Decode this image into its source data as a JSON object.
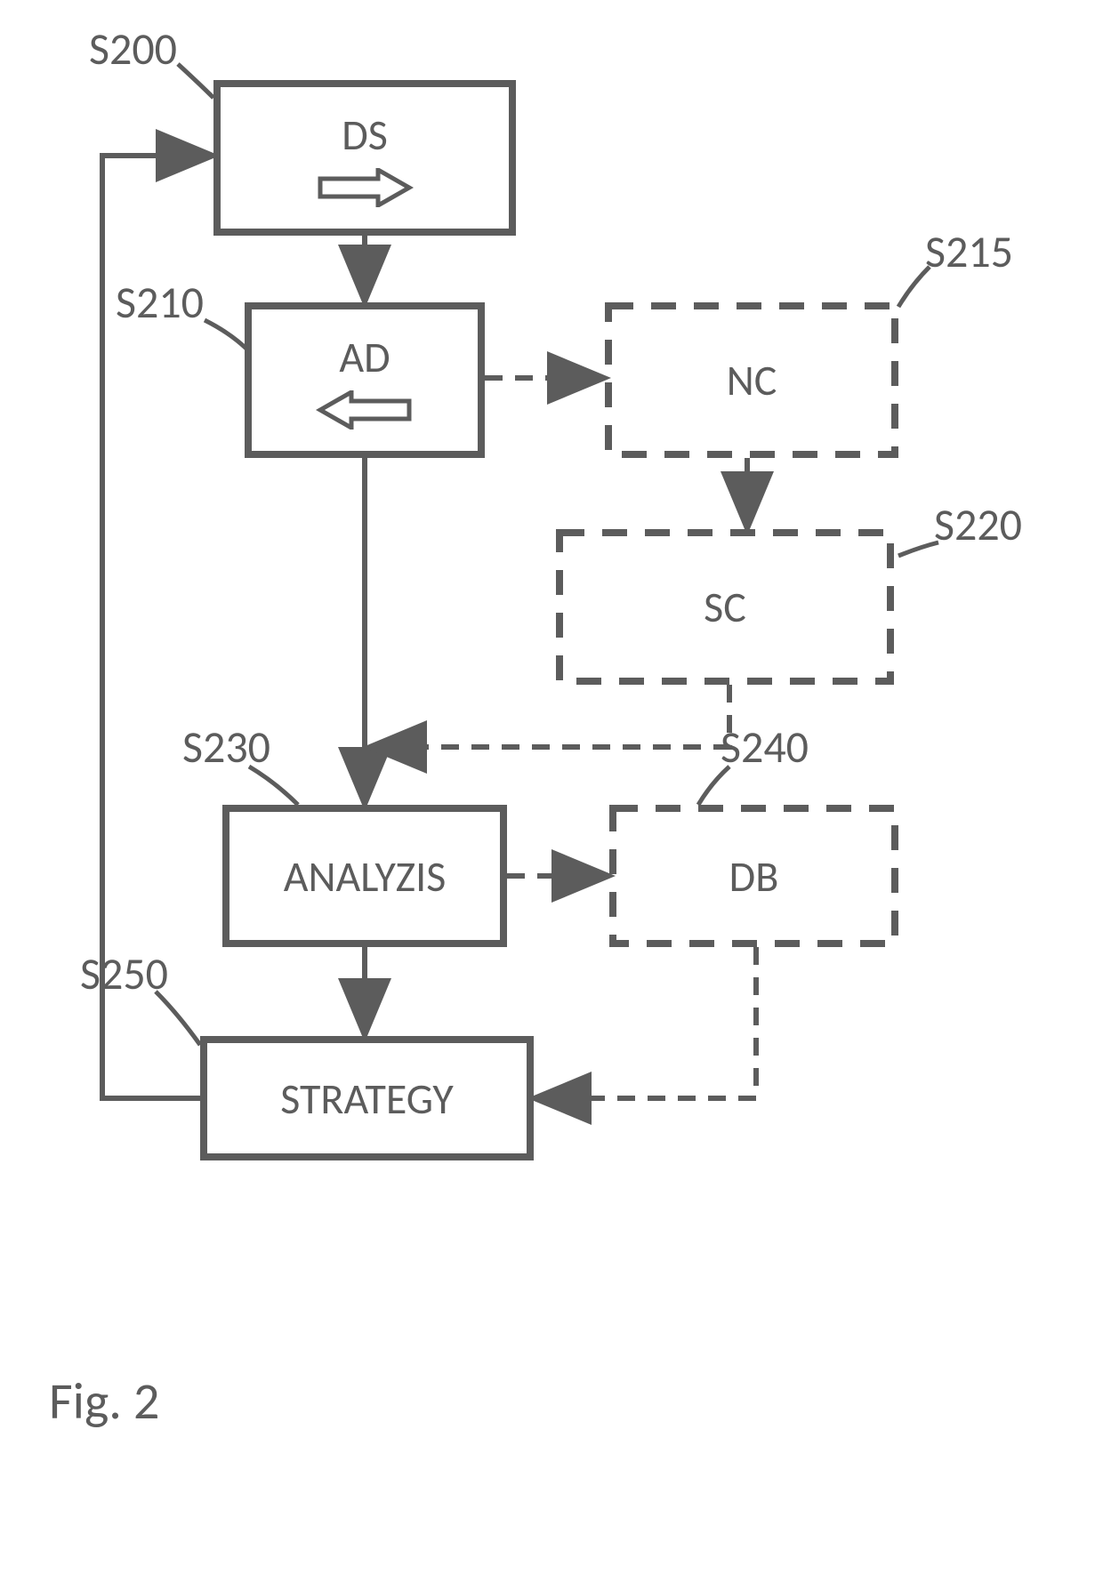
{
  "nodes": {
    "s200": {
      "label": "DS"
    },
    "s210": {
      "label": "AD"
    },
    "s215": {
      "label": "NC"
    },
    "s220": {
      "label": "SC"
    },
    "s230": {
      "label": "ANALYZIS"
    },
    "s240": {
      "label": "DB"
    },
    "s250": {
      "label": "STRATEGY"
    }
  },
  "callouts": {
    "s200": "S200",
    "s210": "S210",
    "s215": "S215",
    "s220": "S220",
    "s230": "S230",
    "s240": "S240",
    "s250": "S250"
  },
  "caption": "Fig. 2"
}
